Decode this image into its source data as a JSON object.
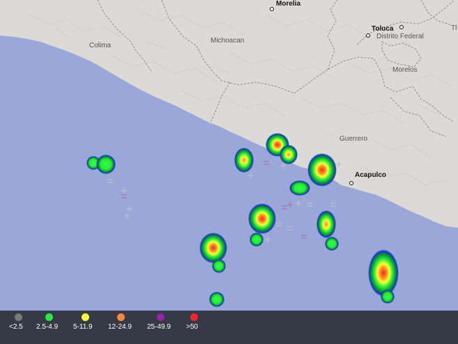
{
  "map": {
    "cities": [
      {
        "name": "Morelia"
      },
      {
        "name": "Toluca"
      },
      {
        "name": "Acapulco"
      }
    ],
    "states": [
      {
        "name": "Colima"
      },
      {
        "name": "Michoacan"
      },
      {
        "name": "Distrito Federal"
      },
      {
        "name": "Morelos"
      },
      {
        "name": "Guerrero"
      },
      {
        "name": "Tl"
      }
    ],
    "colors": {
      "ocean": "#9ba6d9",
      "land": "#dcdad6",
      "border": "#8c8c8c"
    }
  },
  "legend": {
    "items": [
      {
        "label": "<2.5",
        "color": "#7a7a7a"
      },
      {
        "label": "2.5-4.9",
        "color": "#22ee33"
      },
      {
        "label": "5-11.9",
        "color": "#ffff33"
      },
      {
        "label": "12-24.9",
        "color": "#ff8833"
      },
      {
        "label": "25-49.9",
        "color": "#9922aa"
      },
      {
        "label": ">50",
        "color": "#ff2222"
      }
    ]
  }
}
